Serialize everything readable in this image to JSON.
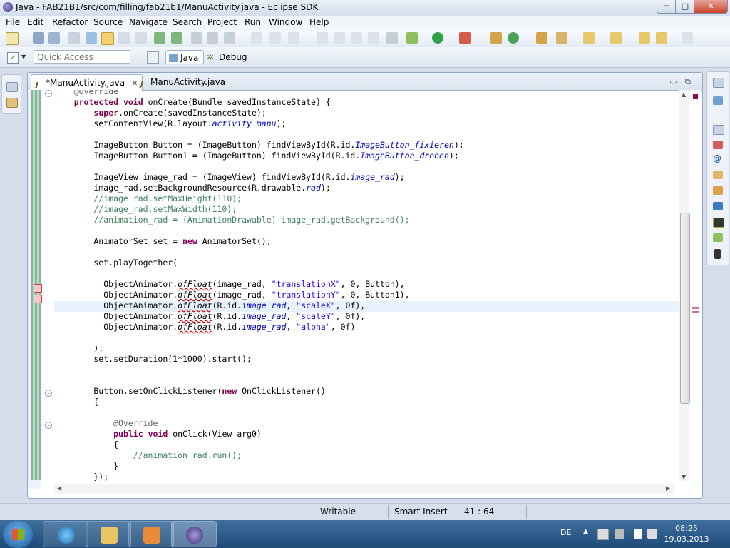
{
  "window": {
    "title": "Java - FAB21B1/src/com/filling/fab21b1/ManuActivity.java - Eclipse SDK",
    "controls": {
      "minimize": "─",
      "maximize": "□",
      "close": "✕"
    }
  },
  "menu": [
    "File",
    "Edit",
    "Refactor",
    "Source",
    "Navigate",
    "Search",
    "Project",
    "Run",
    "Window",
    "Help"
  ],
  "quick_access": {
    "placeholder": "Quick Access"
  },
  "perspectives": {
    "java": "Java",
    "debug": "Debug"
  },
  "editor": {
    "tabs": [
      {
        "label": "*ManuActivity.java",
        "close": "✕"
      },
      {
        "label": "ManuActivity.java"
      }
    ],
    "lines": [
      {
        "n": "l0",
        "t": "    @Override"
      },
      {
        "n": "l1",
        "t": "    protected void onCreate(Bundle savedInstanceState) {"
      },
      {
        "n": "l2",
        "t": "        super.onCreate(savedInstanceState);"
      },
      {
        "n": "l3",
        "t": "        setContentView(R.layout.activity_manu);"
      },
      {
        "n": "l4",
        "t": ""
      },
      {
        "n": "l5",
        "t": "        ImageButton Button = (ImageButton) findViewById(R.id.ImageButton_fixieren);"
      },
      {
        "n": "l6",
        "t": "        ImageButton Button1 = (ImageButton) findViewById(R.id.ImageButton_drehen);"
      },
      {
        "n": "l7",
        "t": ""
      },
      {
        "n": "l8",
        "t": "        ImageView image_rad = (ImageView) findViewById(R.id.image_rad);"
      },
      {
        "n": "l9",
        "t": "        image_rad.setBackgroundResource(R.drawable.rad);"
      },
      {
        "n": "l10",
        "t": "        //image_rad.setMaxHeight(110);"
      },
      {
        "n": "l11",
        "t": "        //image_rad.setMaxWidth(110);"
      },
      {
        "n": "l12",
        "t": "        //animation_rad = (AnimationDrawable) image_rad.getBackground();"
      },
      {
        "n": "l13",
        "t": ""
      },
      {
        "n": "l14",
        "t": "        AnimatorSet set = new AnimatorSet();"
      },
      {
        "n": "l15",
        "t": ""
      },
      {
        "n": "l16",
        "t": "        set.playTogether("
      },
      {
        "n": "l17",
        "t": ""
      },
      {
        "n": "l18",
        "t": "          ObjectAnimator.ofFloat(image_rad, \"translationX\", 0, Button),"
      },
      {
        "n": "l19",
        "t": "          ObjectAnimator.ofFloat(image_rad, \"translationY\", 0, Button1),"
      },
      {
        "n": "l20",
        "t": "          ObjectAnimator.ofFloat(R.id.image_rad, \"scaleX\", 0f),"
      },
      {
        "n": "l21",
        "t": "          ObjectAnimator.ofFloat(R.id.image_rad, \"scaleY\", 0f),"
      },
      {
        "n": "l22",
        "t": "          ObjectAnimator.ofFloat(R.id.image_rad, \"alpha\", 0f)"
      },
      {
        "n": "l23",
        "t": ""
      },
      {
        "n": "l24",
        "t": "        );"
      },
      {
        "n": "l25",
        "t": "        set.setDuration(1*1000).start();"
      },
      {
        "n": "l26",
        "t": ""
      },
      {
        "n": "l27",
        "t": ""
      },
      {
        "n": "l28",
        "t": "        Button.setOnClickListener(new OnClickListener()"
      },
      {
        "n": "l29",
        "t": "        {"
      },
      {
        "n": "l30",
        "t": ""
      },
      {
        "n": "l31",
        "t": "            @Override"
      },
      {
        "n": "l32",
        "t": "            public void onClick(View arg0)"
      },
      {
        "n": "l33",
        "t": "            {"
      },
      {
        "n": "l34",
        "t": "                //animation_rad.run();"
      },
      {
        "n": "l35",
        "t": "            }"
      },
      {
        "n": "l36",
        "t": "        });"
      }
    ]
  },
  "status": {
    "writable": "Writable",
    "insert_mode": "Smart Insert",
    "position": "41 : 64"
  },
  "taskbar": {
    "language": "DE",
    "time": "08:25",
    "date": "19.03.2013"
  },
  "colors": {
    "keyword": "#7f0055",
    "string": "#2a00ff",
    "comment": "#3f7f5f",
    "field": "#0000c0",
    "current_line": "#e8f2fe"
  }
}
